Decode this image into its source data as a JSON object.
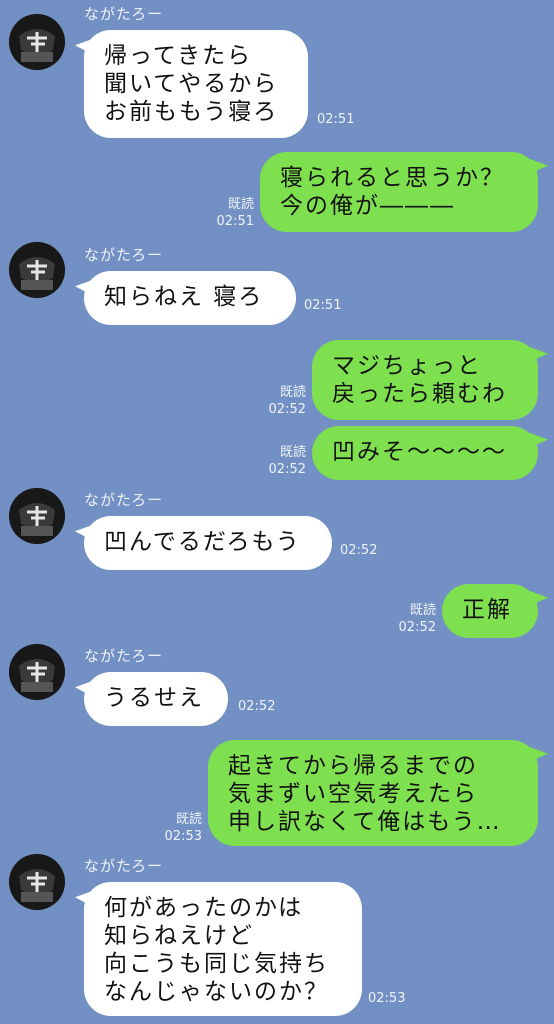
{
  "messages": [
    {
      "dir": "in",
      "sender": "ながたろー",
      "text": "帰ってきたら\n聞いてやるから\nお前ももう寝ろ",
      "time": "02:51"
    },
    {
      "dir": "out",
      "read": "既読",
      "text": "寝られると思うか？\n今の俺が―――",
      "time": "02:51"
    },
    {
      "dir": "in",
      "sender": "ながたろー",
      "text": "知らねえ 寝ろ",
      "time": "02:51"
    },
    {
      "dir": "out",
      "read": "既読",
      "text": "マジちょっと\n戻ったら頼むわ",
      "time": "02:52"
    },
    {
      "dir": "out",
      "read": "既読",
      "text": "凹みそ〜〜〜〜",
      "time": "02:52"
    },
    {
      "dir": "in",
      "sender": "ながたろー",
      "text": "凹んでるだろもう",
      "time": "02:52"
    },
    {
      "dir": "out",
      "read": "既読",
      "text": "正解",
      "time": "02:52"
    },
    {
      "dir": "in",
      "sender": "ながたろー",
      "text": "うるせえ",
      "time": "02:52"
    },
    {
      "dir": "out",
      "read": "既読",
      "text": "起きてから帰るまでの\n気まずい空気考えたら\n申し訳なくて俺はもう…",
      "time": "02:53"
    },
    {
      "dir": "in",
      "sender": "ながたろー",
      "text": "何があったのかは\n知らねえけど\n向こうも同じ気持ち\nなんじゃないのか？",
      "time": "02:53"
    }
  ]
}
